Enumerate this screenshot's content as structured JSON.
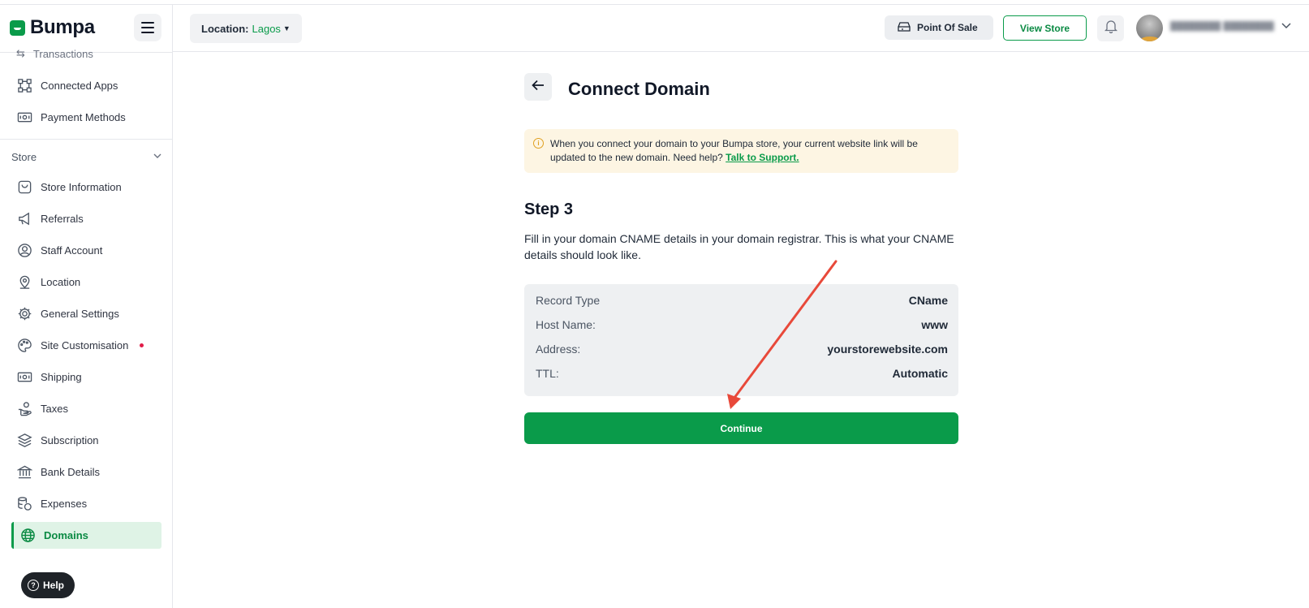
{
  "brand": {
    "name": "Bumpa"
  },
  "sidebar": {
    "partial_item": "Transactions",
    "items_top": [
      {
        "label": "Connected Apps",
        "icon": "connected-apps-icon"
      },
      {
        "label": "Payment Methods",
        "icon": "payment-methods-icon"
      }
    ],
    "section": "Store",
    "items": [
      {
        "label": "Store Information",
        "icon": "store-info-icon"
      },
      {
        "label": "Referrals",
        "icon": "megaphone-icon"
      },
      {
        "label": "Staff Account",
        "icon": "user-circle-icon"
      },
      {
        "label": "Location",
        "icon": "map-pin-icon"
      },
      {
        "label": "General Settings",
        "icon": "gear-icon"
      },
      {
        "label": "Site Customisation",
        "icon": "palette-icon"
      },
      {
        "label": "Shipping",
        "icon": "shipping-icon"
      },
      {
        "label": "Taxes",
        "icon": "taxes-icon"
      },
      {
        "label": "Subscription",
        "icon": "layers-icon"
      },
      {
        "label": "Bank Details",
        "icon": "bank-icon"
      },
      {
        "label": "Expenses",
        "icon": "expenses-icon"
      },
      {
        "label": "Domains",
        "icon": "globe-icon"
      }
    ],
    "help_label": "Help"
  },
  "header": {
    "location_label": "Location:",
    "location_value": "Lagos",
    "point_of_sale": "Point Of Sale",
    "view_store": "View Store"
  },
  "main": {
    "title": "Connect Domain",
    "notice_text": "When you connect your domain to your Bumpa store, your current website link will be updated to the new domain. Need help?",
    "notice_link": "Talk to Support.",
    "step_title": "Step 3",
    "description": "Fill in your domain CNAME details in your domain registrar. This is what your CNAME details should look like.",
    "records": [
      {
        "key": "Record Type",
        "value": "CName"
      },
      {
        "key": "Host Name:",
        "value": "www"
      },
      {
        "key": "Address:",
        "value": "yourstorewebsite.com"
      },
      {
        "key": "TTL:",
        "value": "Automatic"
      }
    ],
    "continue_label": "Continue"
  },
  "colors": {
    "accent": "#0a9b4a",
    "notice_bg": "#fdf5e3",
    "annotation_arrow": "#e8493a"
  }
}
